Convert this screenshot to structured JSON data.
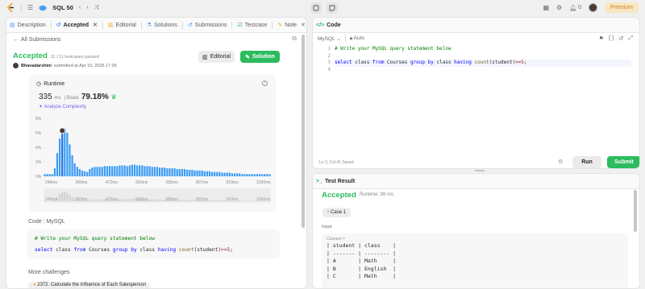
{
  "topbar": {
    "problem_set": "SQL 50",
    "premium": "Premium",
    "notif_count": "0"
  },
  "left_tabs": [
    {
      "label": "Description",
      "icon": "description-icon"
    },
    {
      "label": "Accepted",
      "icon": "history-icon",
      "active": true
    },
    {
      "label": "Editorial",
      "icon": "book-icon"
    },
    {
      "label": "Solutions",
      "icon": "flask-icon"
    },
    {
      "label": "Submissions",
      "icon": "history-icon"
    },
    {
      "label": "Testcase",
      "icon": "checkbox-icon"
    },
    {
      "label": "Note",
      "icon": "note-icon"
    }
  ],
  "submission": {
    "back_label": "All Submissions",
    "status": "Accepted",
    "passed": "11 / 11 testcases passed",
    "user": "Bhavadarshini",
    "submitted": "submitted at Apr 15, 2025 17:05",
    "editorial_btn": "Editorial",
    "solution_btn": "Solution"
  },
  "runtime": {
    "header": "Runtime",
    "value": "335",
    "unit": "ms",
    "beats_label": "Beats",
    "beats_value": "79.18%",
    "analyze": "Analyze Complexity"
  },
  "chart_data": {
    "type": "bar",
    "ylabel": "",
    "y_ticks": [
      "8%",
      "6%",
      "4%",
      "2%",
      "0%"
    ],
    "ylim": [
      0,
      8
    ],
    "x_ticks": [
      "249ms",
      "360ms",
      "472ms",
      "583ms",
      "695ms",
      "807ms",
      "919ms",
      "1030ms"
    ],
    "values": [
      0.3,
      0.3,
      0.3,
      0.3,
      1.1,
      3.2,
      5.2,
      6.3,
      6.6,
      6.0,
      4.4,
      2.9,
      1.8,
      1.3,
      1.0,
      0.8,
      0.7,
      0.6,
      1.0,
      1.2,
      1.3,
      1.3,
      1.3,
      1.3,
      1.4,
      1.4,
      1.4,
      1.4,
      1.4,
      1.4,
      1.5,
      1.5,
      1.5,
      1.4,
      1.5,
      1.6,
      1.6,
      1.5,
      1.5,
      1.5,
      1.4,
      1.4,
      1.4,
      1.3,
      1.3,
      1.3,
      1.2,
      1.2,
      1.2,
      1.1,
      1.1,
      1.1,
      1.1,
      1.0,
      1.0,
      1.0,
      1.0,
      0.9,
      0.9,
      0.9,
      0.8,
      0.8,
      0.8,
      0.8,
      0.7,
      0.7,
      0.7,
      0.6,
      0.6,
      0.6,
      0.6,
      0.5,
      0.5,
      0.5,
      0.5,
      0.4,
      0.4,
      0.4,
      0.4,
      0.3,
      0.3,
      0.3,
      0.3,
      0.3,
      0.3,
      0.3,
      0.3,
      0.3,
      0.3,
      0.3,
      0.3
    ],
    "highlight_index": 7,
    "grid": true
  },
  "code_section": {
    "label_code": "Code",
    "label_lang": "MySQL",
    "line1": "# Write your MySQL query statement below",
    "line2_parts": [
      "select",
      " class ",
      "from",
      " Courses ",
      "group",
      " ",
      "by",
      " class ",
      "having",
      " ",
      "count",
      "(student)",
      ">=",
      "5",
      ";"
    ]
  },
  "more_challenges": {
    "label": "More challenges",
    "item": "2372. Calculate the Influence of Each Salesperson"
  },
  "code_panel": {
    "title": "Code",
    "lang": "MySQL",
    "auto": "Auto",
    "lines": [
      "1",
      "2",
      "3",
      "4"
    ],
    "comment": "# Write your MySQL query statement below",
    "status": "Ln 3, Col 41   Saved",
    "run": "Run",
    "submit": "Submit"
  },
  "test_panel": {
    "title": "Test Result",
    "status": "Accepted",
    "runtime": "Runtime: 98 ms",
    "case": "Case 1",
    "input_label": "Input",
    "table_name": "Courses =",
    "table_rows": [
      "| student | class    |",
      "| ------- | -------- |",
      "| A       | Math     |",
      "| B       | English  |",
      "| C       | Math     |"
    ]
  }
}
